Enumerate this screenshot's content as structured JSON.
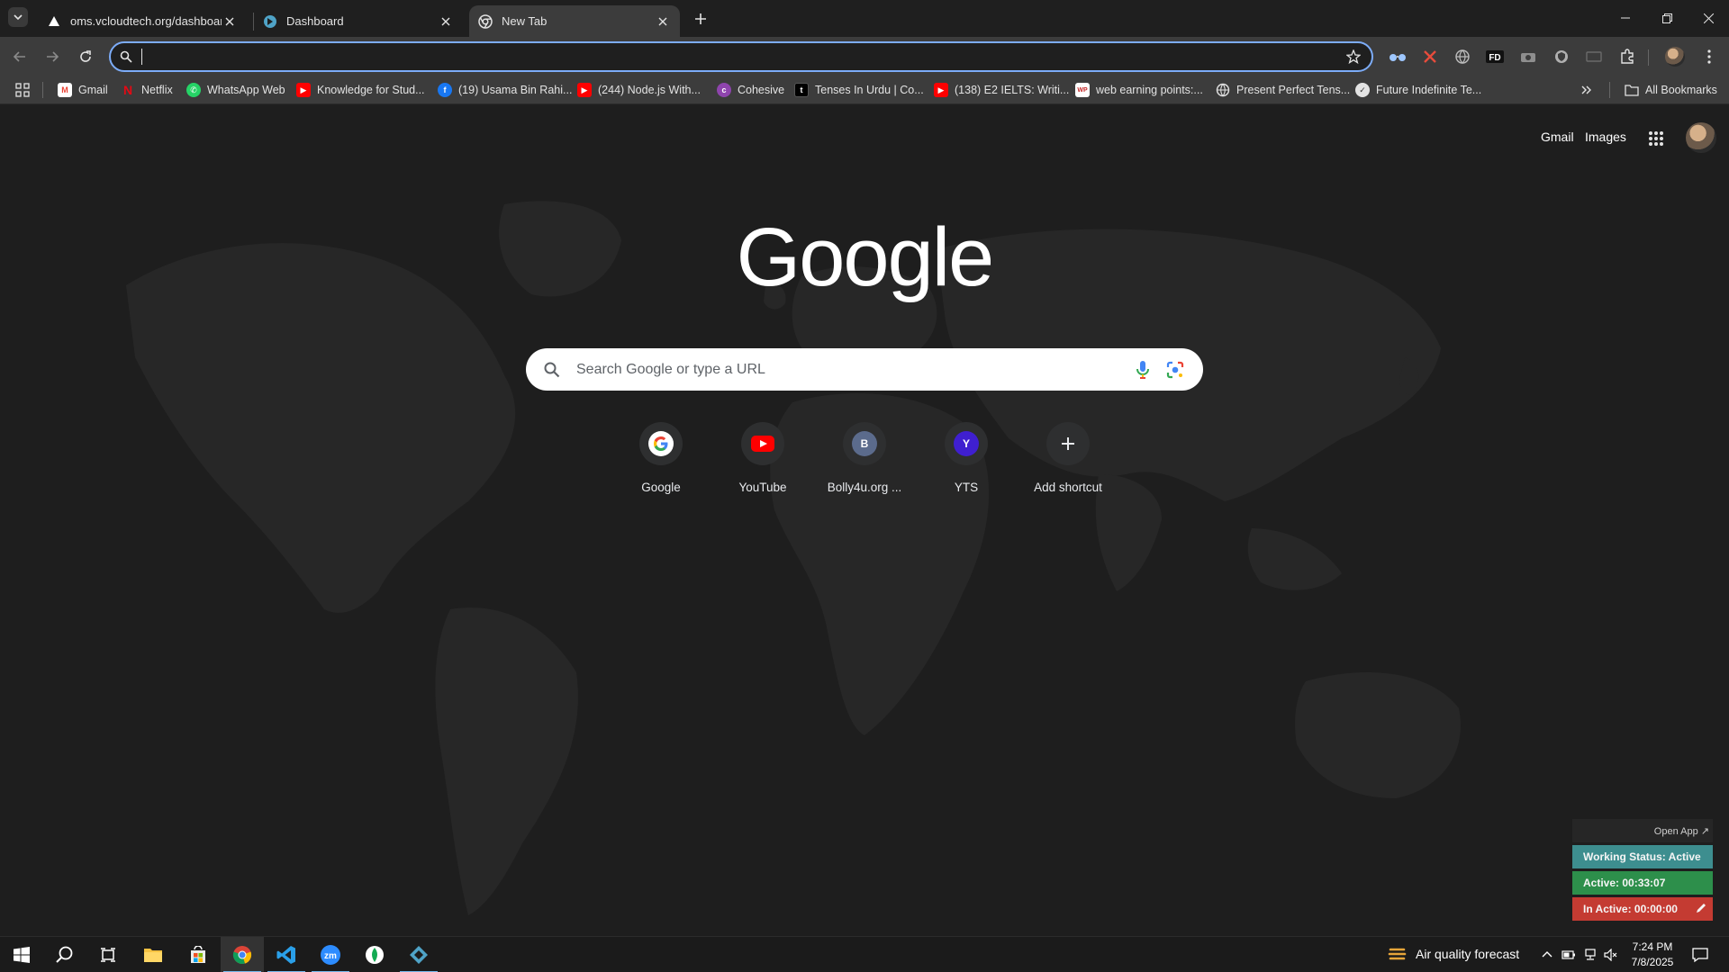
{
  "tabs": [
    {
      "title": "oms.vcloudtech.org/dashboard",
      "active": false
    },
    {
      "title": "Dashboard",
      "active": false
    },
    {
      "title": "New Tab",
      "active": true
    }
  ],
  "omnibox": {
    "value": "",
    "placeholder": ""
  },
  "bookmarks": [
    {
      "label": "Gmail",
      "icon": "gmail-icon",
      "color": "#ea4335"
    },
    {
      "label": "Netflix",
      "icon": "netflix-icon",
      "color": "#e50914"
    },
    {
      "label": "WhatsApp Web",
      "icon": "whatsapp-icon",
      "color": "#25d366"
    },
    {
      "label": "Knowledge for Stud...",
      "icon": "youtube-icon",
      "color": "#ff0000"
    },
    {
      "label": "(19) Usama Bin Rahi...",
      "icon": "facebook-icon",
      "color": "#1877f2"
    },
    {
      "label": "(244) Node.js With...",
      "icon": "youtube-icon",
      "color": "#ff0000"
    },
    {
      "label": "Cohesive",
      "icon": "cohesive-icon",
      "color": "#8e44ad"
    },
    {
      "label": "Tenses In Urdu | Co...",
      "icon": "site-icon",
      "color": "#000000"
    },
    {
      "label": "(138) E2 IELTS: Writi...",
      "icon": "youtube-icon",
      "color": "#ff0000"
    },
    {
      "label": "web earning points:...",
      "icon": "wp-icon",
      "color": "#c62828"
    },
    {
      "label": "Present Perfect Tens...",
      "icon": "globe-icon",
      "color": "#e3e3e3"
    },
    {
      "label": "Future Indefinite Te...",
      "icon": "site-icon",
      "color": "#e3e3e3"
    }
  ],
  "all_bookmarks": "All Bookmarks",
  "ntp": {
    "gmail": "Gmail",
    "images": "Images",
    "search_placeholder": "Search Google or type a URL",
    "shortcuts": [
      {
        "label": "Google",
        "badge": "G",
        "color": "#ffffff"
      },
      {
        "label": "YouTube",
        "badge": "",
        "color": "#ff0000"
      },
      {
        "label": "Bolly4u.org ...",
        "badge": "B",
        "color": "#5b6b8c"
      },
      {
        "label": "YTS",
        "badge": "Y",
        "color": "#3f1fd0"
      },
      {
        "label": "Add shortcut",
        "badge": "+",
        "color": "#2e2f30"
      }
    ]
  },
  "widget": {
    "open_app": "Open App ↗",
    "working": "Working Status: Active",
    "active": "Active: 00:33:07",
    "inactive": "In Active: 00:00:00"
  },
  "taskbar": {
    "weather": "Air quality forecast",
    "time": "7:24 PM",
    "date": "7/8/2025"
  }
}
